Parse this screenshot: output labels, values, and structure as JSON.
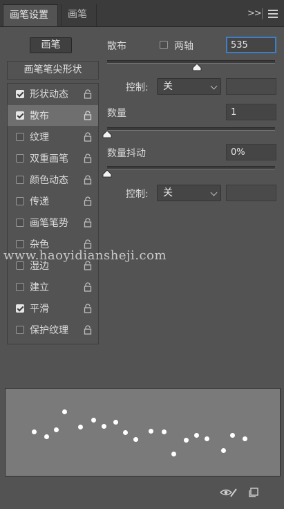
{
  "tabs": [
    {
      "label": "画笔设置",
      "active": true
    },
    {
      "label": "画笔",
      "active": false
    }
  ],
  "panel_controls": {
    "collapse_label": ">>",
    "menu_icon": "hamburger-menu-icon"
  },
  "brushes_button": "画笔",
  "brush_tip_shape": "画笔笔尖形状",
  "options": [
    {
      "label": "形状动态",
      "checked": true,
      "selected": false
    },
    {
      "label": "散布",
      "checked": true,
      "selected": true
    },
    {
      "label": "纹理",
      "checked": false,
      "selected": false
    },
    {
      "label": "双重画笔",
      "checked": false,
      "selected": false
    },
    {
      "label": "颜色动态",
      "checked": false,
      "selected": false
    },
    {
      "label": "传递",
      "checked": false,
      "selected": false
    },
    {
      "label": "画笔笔势",
      "checked": false,
      "selected": false
    },
    {
      "label": "杂色",
      "checked": false,
      "selected": false
    },
    {
      "label": "湿边",
      "checked": false,
      "selected": false
    },
    {
      "label": "建立",
      "checked": false,
      "selected": false
    },
    {
      "label": "平滑",
      "checked": true,
      "selected": false
    },
    {
      "label": "保护纹理",
      "checked": false,
      "selected": false
    }
  ],
  "scatter": {
    "label": "散布",
    "both_axes_label": "两轴",
    "both_axes_checked": false,
    "value": "535",
    "slider_fraction": 0.535,
    "control_label": "控制:",
    "control_value": "关",
    "control_amount": ""
  },
  "count": {
    "label": "数量",
    "value": "1",
    "slider_fraction": 0.0
  },
  "count_jitter": {
    "label": "数量抖动",
    "value": "0%",
    "slider_fraction": 0.0,
    "control_label": "控制:",
    "control_value": "关",
    "control_amount": ""
  },
  "watermark": "www.haoyidiansheji.com",
  "preview_icons": [
    "eye-brush-icon",
    "new-preset-icon"
  ],
  "colors": {
    "panel": "#535353",
    "tabbar": "#3b3b3b",
    "selected_row": "#6f6f6f",
    "focus_border": "#3c7fc4"
  }
}
